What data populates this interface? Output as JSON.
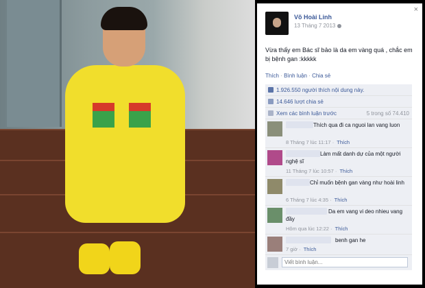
{
  "post": {
    "author": "Võ Hoài Linh",
    "date": "13 Tháng 7 2013",
    "text": "Vừa thấy em Bác sĩ bảo là da em vàng quá , chắc em bị bệnh gan :kkkkk",
    "actions": [
      "Thích",
      "Bình luận",
      "Chia sẻ"
    ],
    "close_icon": "×"
  },
  "ufi": {
    "likes": "1.926.550 người thích nội dung này.",
    "shares": "14.646 lượt chia sẻ",
    "view_previous": "Xem các bình luận trước",
    "pager": "5 trong số 74.410"
  },
  "comments": [
    {
      "text": "Thích qua đi ca nguoi lan vang luon",
      "time": "8 Tháng 7 lúc 11:17",
      "like": "Thích",
      "avatar_color": "#8a8f7a"
    },
    {
      "text": "Làm mất danh dự của một người nghệ sĩ",
      "time": "11 Tháng 7 lúc 10:57",
      "like": "Thích",
      "avatar_color": "#b04a8a"
    },
    {
      "text": "Chỉ muốn bệnh gan vàng như hoài linh",
      "time": "6 Tháng 7 lúc 4:35",
      "like": "Thích",
      "avatar_color": "#8f8a6a"
    },
    {
      "text": "Da em vang vi deo nhieu vang đầy",
      "time": "Hôm qua lúc 12:22",
      "like": "Thích",
      "avatar_color": "#6a8f6a"
    },
    {
      "text": "benh gan he",
      "time": "7 giờ",
      "like": "Thích",
      "avatar_color": "#9a7f7a"
    }
  ],
  "reply_placeholder": "Viết bình luận..."
}
